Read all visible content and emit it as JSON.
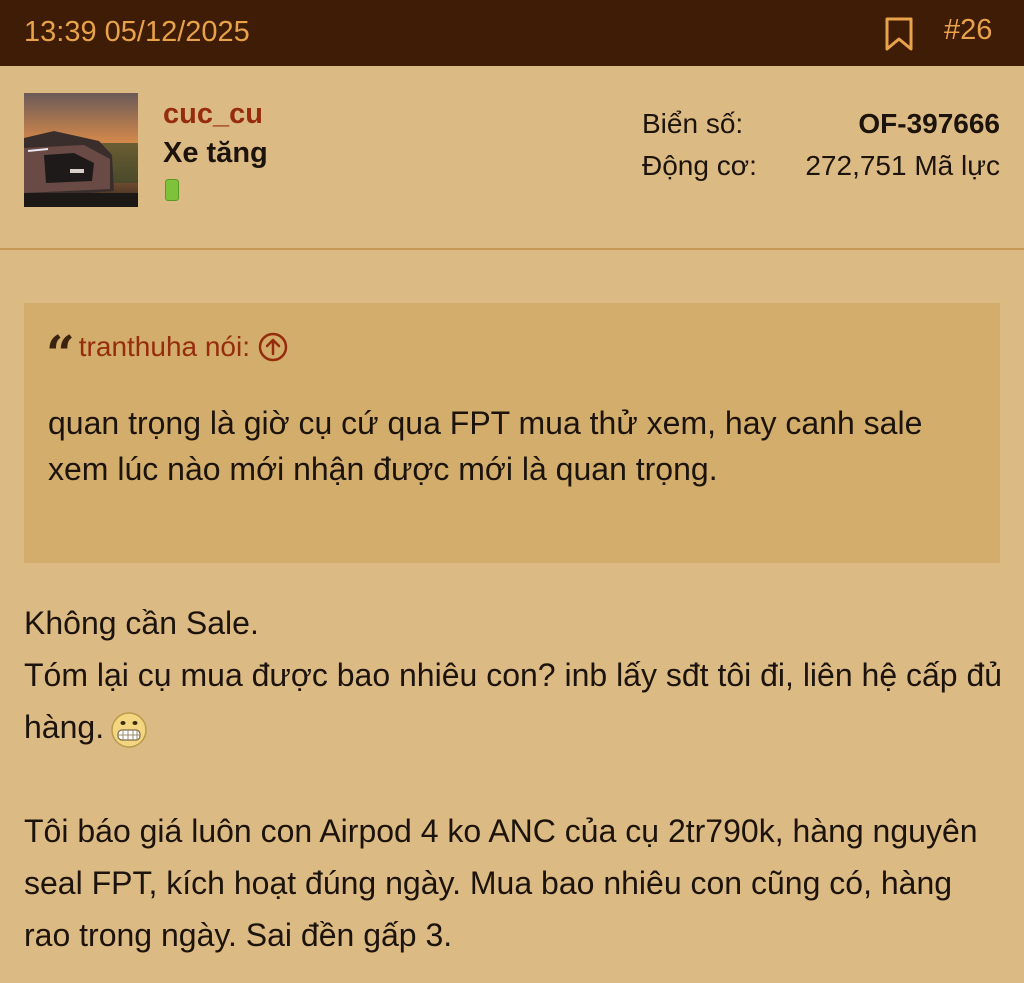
{
  "post": {
    "timestamp": "13:39 05/12/2025",
    "number": "#26",
    "bookmark_icon": "bookmark-icon"
  },
  "user": {
    "username": "cuc_cu",
    "title": "Xe tăng",
    "status_color": "#7ec23a",
    "plate_label": "Biển số:",
    "plate_value": "OF-397666",
    "engine_label": "Động cơ:",
    "engine_value": "272,751 Mã lực"
  },
  "quote": {
    "author_line": "tranthuha nói:",
    "text": "quan trọng là giờ cụ cứ qua FPT mua thử xem, hay canh sale xem lúc nào mới nhận được mới là quan trọng."
  },
  "message": {
    "line1": "Không cần Sale.",
    "line2": "Tóm lại cụ mua được bao nhiêu con? inb lấy sđt tôi đi, liên hệ cấp đủ hàng.",
    "paragraph2": "Tôi báo giá luôn con Airpod 4 ko ANC của cụ 2tr790k, hàng nguyên seal FPT, kích hoạt đúng ngày. Mua bao nhiêu con cũng có, hàng rao trong ngày. Sai đền gấp 3.",
    "emoji": "grin-emoji"
  },
  "colors": {
    "topbar": "#3f1c06",
    "accent": "#e8a24a",
    "background": "#dcba84",
    "quote_bg": "#d2ad6c",
    "username": "#962c0e"
  }
}
